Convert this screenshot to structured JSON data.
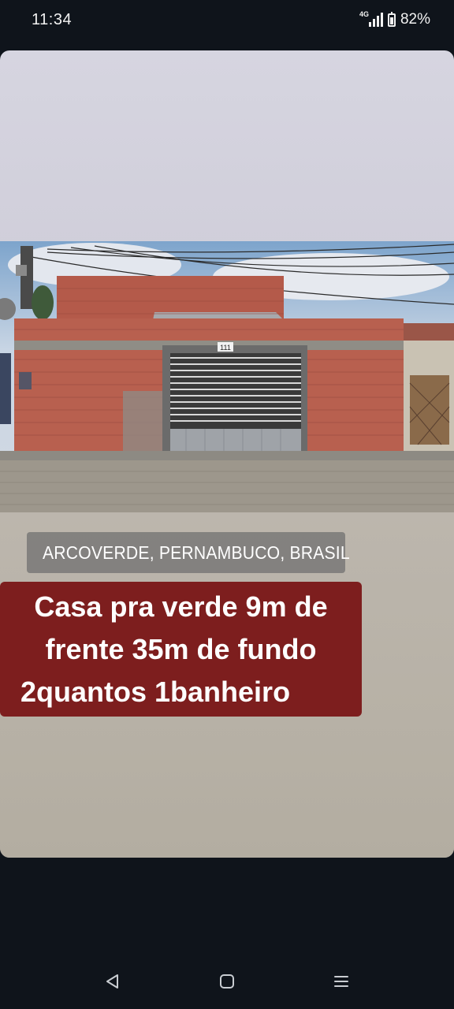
{
  "status_bar": {
    "time": "11:34",
    "network": "4G",
    "battery": "82%"
  },
  "post": {
    "location": "ARCOVERDE, PERNAMBUCO, BRASIL",
    "caption_lines": [
      "Casa pra verde 9m de",
      "frente 35m de fundo",
      "2quantos 1banheiro"
    ],
    "house_number": "111"
  },
  "nav_bar": {
    "back_icon": "triangle-back-icon",
    "home_icon": "square-home-icon",
    "recents_icon": "menu-lines-icon"
  }
}
